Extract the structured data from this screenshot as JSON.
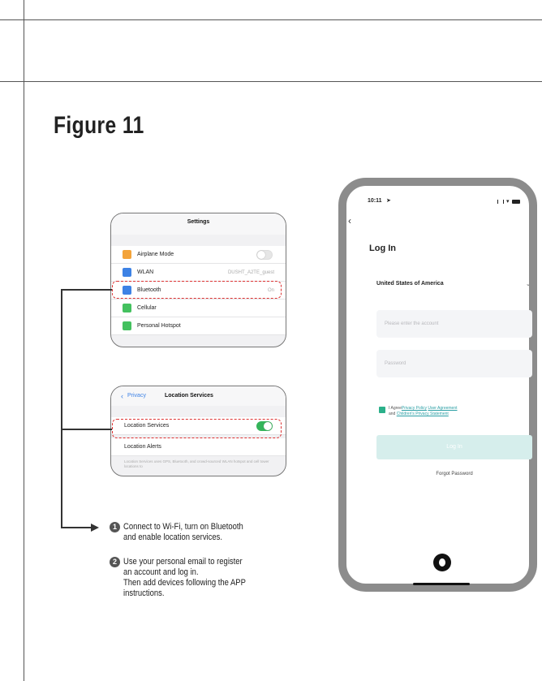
{
  "figure_title": "Figure 11",
  "settings_panel": {
    "header": "Settings",
    "rows": [
      {
        "label": "Airplane Mode",
        "value": "",
        "icon": "airplane-icon",
        "color": "#f3a33a"
      },
      {
        "label": "WLAN",
        "value": "DUSHT_A2TE_guest",
        "icon": "wifi-icon",
        "color": "#3d82e5"
      },
      {
        "label": "Bluetooth",
        "value": "On",
        "icon": "bluetooth-icon",
        "color": "#3d82e5"
      },
      {
        "label": "Cellular",
        "value": "",
        "icon": "cellular-icon",
        "color": "#44c15f"
      },
      {
        "label": "Personal Hotspot",
        "value": "",
        "icon": "hotspot-icon",
        "color": "#44c15f"
      }
    ]
  },
  "location_panel": {
    "back_label": "Privacy",
    "header": "Location Services",
    "rows": [
      {
        "label": "Location Services"
      },
      {
        "label": "Location Alerts"
      }
    ],
    "footer": "Location Services uses GPS, Bluetooth, and crowd-sourced WLAN hotspot and cell tower locations to"
  },
  "steps": [
    {
      "number": "1",
      "lines": [
        "Connect to Wi-Fi, turn on Bluetooth",
        "and enable location services."
      ]
    },
    {
      "number": "2",
      "lines": [
        "Use your personal email to register",
        "an account and log in.",
        "Then add devices following the APP",
        "instructions."
      ]
    }
  ],
  "phone": {
    "time": "10:11",
    "heading": "Log In",
    "country": "United States of America",
    "account_placeholder": "Please enter the account",
    "password_placeholder": "Password",
    "agree_prefix": "I Agree",
    "privacy_link": "Privacy Policy",
    "user_agreement_link": "User Agreement",
    "and_text": "and",
    "children_link": "Children's Privacy Statement",
    "login_button": "Log In",
    "forgot_password": "Forgot Password",
    "accent_color": "#7fcfc5",
    "check_color": "#2bb08a"
  }
}
